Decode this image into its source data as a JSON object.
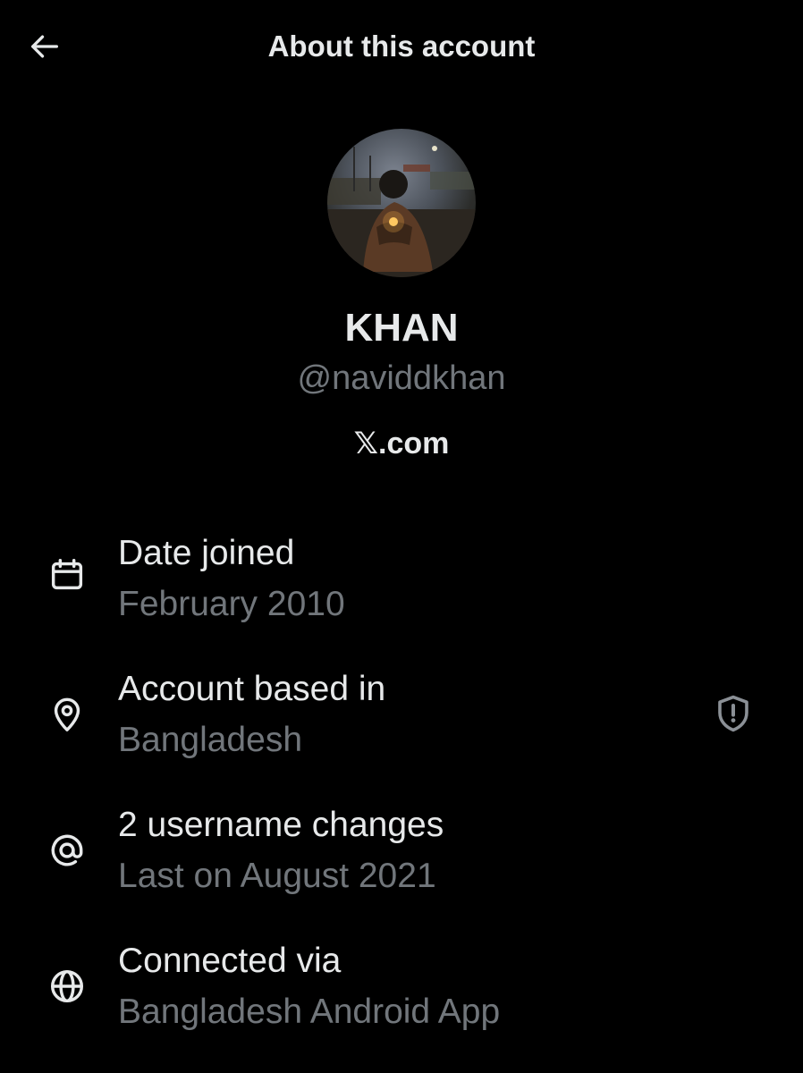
{
  "header": {
    "title": "About this account",
    "back_icon": "arrow-left-icon"
  },
  "profile": {
    "display_name": "KHAN",
    "handle": "@naviddkhan",
    "source": "𝕏.com"
  },
  "details": [
    {
      "icon": "calendar-icon",
      "label": "Date joined",
      "value": "February 2010"
    },
    {
      "icon": "location-pin-icon",
      "label": "Account based in",
      "value": "Bangladesh",
      "badge_icon": "shield-alert-icon"
    },
    {
      "icon": "at-sign-icon",
      "label": "2 username changes",
      "value": "Last on August 2021"
    },
    {
      "icon": "globe-icon",
      "label": "Connected via",
      "value": "Bangladesh Android App"
    }
  ],
  "colors": {
    "background": "#000000",
    "primary_text": "#e7e9ea",
    "secondary_text": "#71767b"
  }
}
